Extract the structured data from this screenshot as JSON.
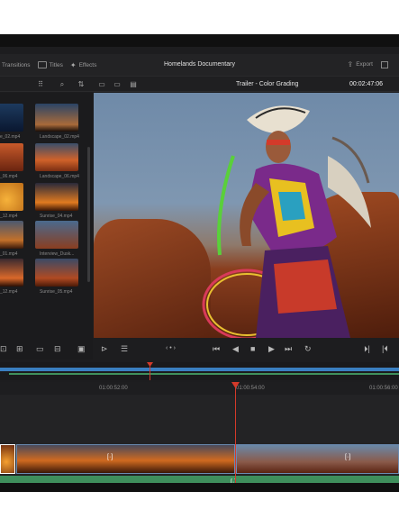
{
  "app": {
    "project_title": "Homelands Documentary",
    "menu": [
      {
        "label": "Transitions",
        "icon": "transitions-icon"
      },
      {
        "label": "Titles",
        "icon": "titles-icon"
      },
      {
        "label": "Effects",
        "icon": "effects-icon"
      }
    ],
    "export_label": "Export"
  },
  "viewer": {
    "clip_name": "Trailer - Color Grading",
    "timecode": "00:02:47:06"
  },
  "media_pool": {
    "items": [
      {
        "label": "Landscape_02.mp4",
        "icon": "clip-thumbnail-icon"
      },
      {
        "label": "Landscape_06.mp4",
        "icon": "clip-thumbnail-icon"
      },
      {
        "label": "Sunrise_04.mp4",
        "icon": "clip-thumbnail-icon"
      },
      {
        "label": "Interview_Dusk...",
        "icon": "clip-thumbnail-icon"
      },
      {
        "label": "Sunrise_05.mp4",
        "icon": "clip-thumbnail-icon"
      }
    ],
    "left_column_labels": [
      "e_02.mp4",
      "_06.mp4",
      "_12.mp4",
      "_01.mp4",
      "_12.mp4"
    ]
  },
  "timeline": {
    "ruler_labels": [
      "01:00:52:00",
      "01:00:54:00",
      "01:00:56:00"
    ]
  },
  "colors": {
    "accent_red": "#d43a2a",
    "accent_blue": "#3a7fc1",
    "audio_green": "#3f8f5c"
  }
}
